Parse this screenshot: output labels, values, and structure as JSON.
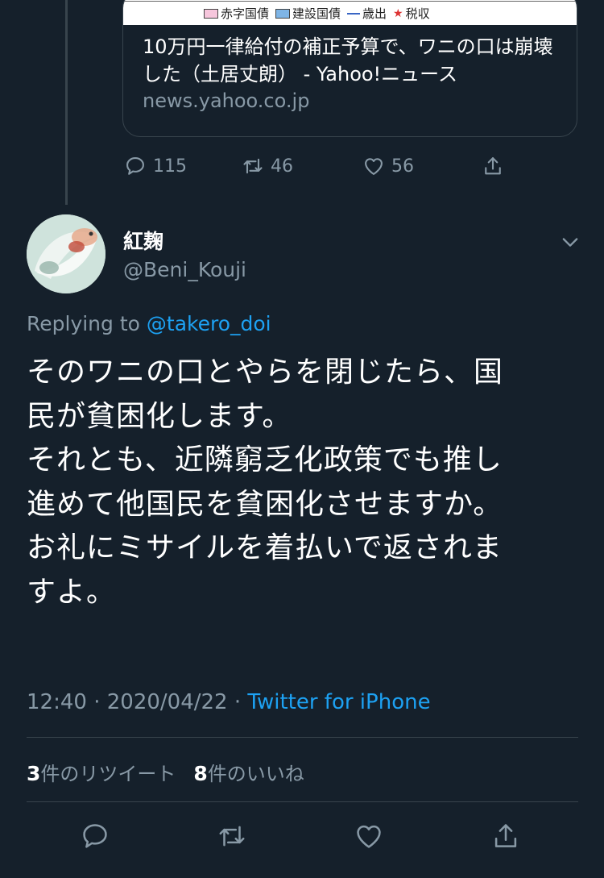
{
  "link_card": {
    "chart_legend": [
      "赤字国債",
      "建設国債",
      "歳出",
      "税収"
    ],
    "title": "10万円一律給付の補正予算で、ワニの口は崩壊した（土居丈朗） - Yahoo!ニュース",
    "domain": "news.yahoo.co.jp"
  },
  "parent_actions": {
    "reply_count": "115",
    "retweet_count": "46",
    "like_count": "56"
  },
  "tweet": {
    "author_name": "紅麹",
    "author_handle": "@Beni_Kouji",
    "replying_prefix": "Replying to",
    "replying_mention": "@takero_doi",
    "lines": [
      "そのワニの口とやらを閉じたら、国",
      "民が貧困化します。",
      "それとも、近隣窮乏化政策でも推し",
      "進めて他国民を貧困化させますか。",
      "お礼にミサイルを着払いで返されま",
      "すよ。"
    ],
    "time": "12:40",
    "date": "2020/04/22",
    "separator": "·",
    "source": "Twitter for iPhone"
  },
  "stats": {
    "retweets_count": "3",
    "retweets_label": "件のリツイート",
    "likes_count": "8",
    "likes_label": "件のいいね"
  },
  "colors": {
    "background": "#15202b",
    "secondary_text": "#8899a6",
    "link": "#1da1f2",
    "divider": "#38444d"
  }
}
